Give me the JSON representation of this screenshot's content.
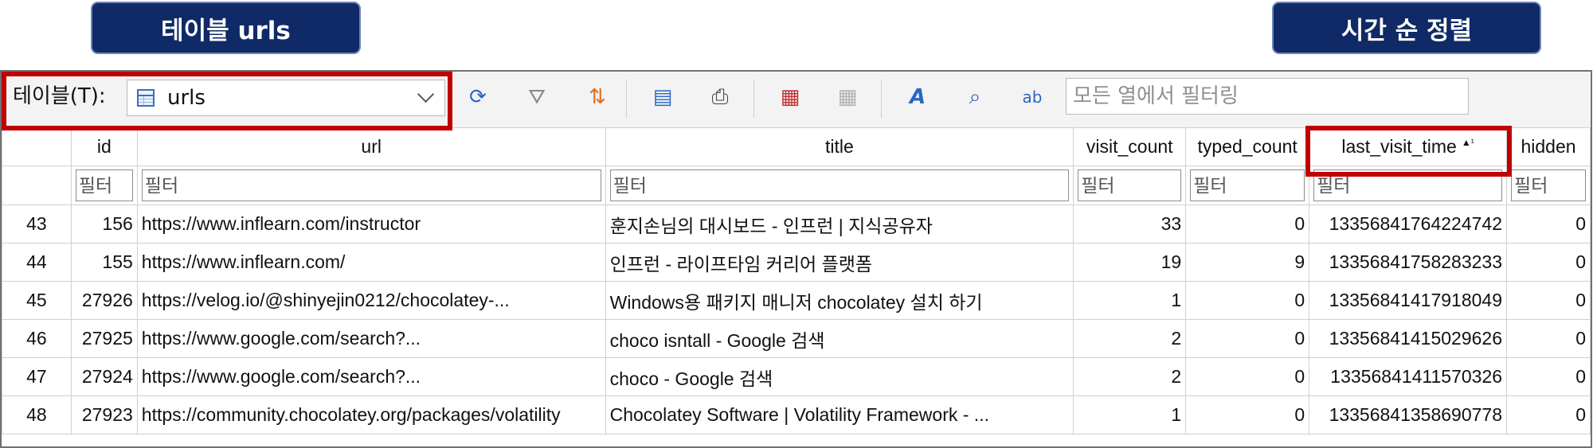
{
  "callouts": {
    "left": "테이블 urls",
    "right": "시간 순 정렬"
  },
  "toolbar": {
    "table_label": "테이블(T):",
    "table_value": "urls",
    "filter_placeholder": "모든 열에서 필터링"
  },
  "colors": {
    "callout_bg": "#0f2a66",
    "highlight": "#c00000"
  },
  "columns": [
    "id",
    "url",
    "title",
    "visit_count",
    "typed_count",
    "last_visit_time",
    "hidden"
  ],
  "sort": {
    "column": "last_visit_time",
    "indicator": "▲¹"
  },
  "filter_placeholder": "필터",
  "rows": [
    {
      "row": "43",
      "id": "156",
      "url": "https://www.inflearn.com/instructor",
      "title": "훈지손님의 대시보드 - 인프런 | 지식공유자",
      "visit_count": "33",
      "typed_count": "0",
      "last_visit_time": "13356841764224742",
      "hidden": "0"
    },
    {
      "row": "44",
      "id": "155",
      "url": "https://www.inflearn.com/",
      "title": "인프런 - 라이프타임 커리어 플랫폼",
      "visit_count": "19",
      "typed_count": "9",
      "last_visit_time": "13356841758283233",
      "hidden": "0"
    },
    {
      "row": "45",
      "id": "27926",
      "url": "https://velog.io/@shinyejin0212/chocolatey-...",
      "title": "Windows용 패키지 매니저 chocolatey 설치 하기",
      "visit_count": "1",
      "typed_count": "0",
      "last_visit_time": "13356841417918049",
      "hidden": "0"
    },
    {
      "row": "46",
      "id": "27925",
      "url": "https://www.google.com/search?...",
      "title": "choco isntall - Google 검색",
      "visit_count": "2",
      "typed_count": "0",
      "last_visit_time": "13356841415029626",
      "hidden": "0"
    },
    {
      "row": "47",
      "id": "27924",
      "url": "https://www.google.com/search?...",
      "title": "choco - Google 검색",
      "visit_count": "2",
      "typed_count": "0",
      "last_visit_time": "13356841411570326",
      "hidden": "0"
    },
    {
      "row": "48",
      "id": "27923",
      "url": "https://community.chocolatey.org/packages/volatility",
      "title": "Chocolatey Software | Volatility Framework - ...",
      "visit_count": "1",
      "typed_count": "0",
      "last_visit_time": "13356841358690778",
      "hidden": "0"
    }
  ]
}
